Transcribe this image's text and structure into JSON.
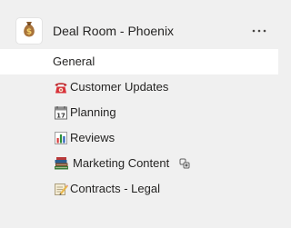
{
  "team": {
    "name": "Deal Room - Phoenix",
    "avatar_icon": "money-bag-icon",
    "more_icon": "more-options-icon"
  },
  "channels": [
    {
      "label": "General",
      "icon": null,
      "selected": true
    },
    {
      "label": "Customer Updates",
      "icon": "telephone-icon",
      "selected": false
    },
    {
      "label": "Planning",
      "icon": "calendar-icon",
      "selected": false
    },
    {
      "label": "Reviews",
      "icon": "bar-chart-icon",
      "selected": false
    },
    {
      "label": "Marketing Content",
      "icon": "books-icon",
      "selected": false,
      "trailing_icon": "shared-channel-icon"
    },
    {
      "label": "Contracts - Legal",
      "icon": "memo-icon",
      "selected": false
    }
  ],
  "colors": {
    "background": "#f0f0f0",
    "selected_row": "#ffffff",
    "text": "#252423"
  }
}
